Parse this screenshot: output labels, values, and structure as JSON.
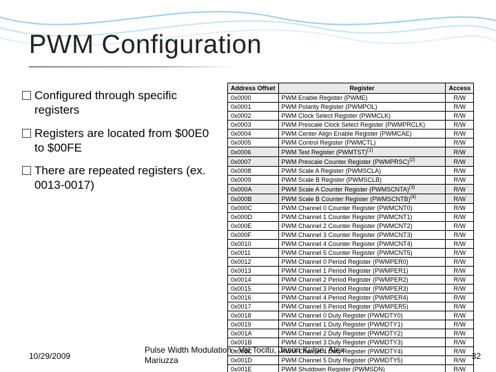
{
  "title": "PWM Configuration",
  "bullets": [
    "Configured through specific registers",
    "Registers are located from $00E0 to $00FE",
    "There are repeated registers (ex. 0013-0017)"
  ],
  "table": {
    "headers": [
      "Address Offset",
      "Register",
      "Access"
    ],
    "rows": [
      {
        "addr": "0x0000",
        "reg": "PWM Enable Register (PWME)",
        "acc": "R/W",
        "shade": false
      },
      {
        "addr": "0x0001",
        "reg": "PWM Polarity Register (PWMPOL)",
        "acc": "R/W",
        "shade": false
      },
      {
        "addr": "0x0002",
        "reg": "PWM Clock Select Register (PWMCLK)",
        "acc": "R/W",
        "shade": false
      },
      {
        "addr": "0x0003",
        "reg": "PWM Prescale Clock Select Register (PWMPRCLK)",
        "acc": "R/W",
        "shade": false
      },
      {
        "addr": "0x0004",
        "reg": "PWM Center Align Enable Register (PWMCAE)",
        "acc": "R/W",
        "shade": false
      },
      {
        "addr": "0x0005",
        "reg": "PWM Control Register (PWMCTL)",
        "acc": "R/W",
        "shade": false
      },
      {
        "addr": "0x0006",
        "reg": "PWM Test Register (PWMTST)",
        "acc": "R/W",
        "shade": true,
        "sup": "(1)"
      },
      {
        "addr": "0x0007",
        "reg": "PWM Prescale Counter Register (PWMPRSC)",
        "acc": "R/W",
        "shade": true,
        "sup": "(2)"
      },
      {
        "addr": "0x0008",
        "reg": "PWM Scale A Register (PWMSCLA)",
        "acc": "R/W",
        "shade": false
      },
      {
        "addr": "0x0009",
        "reg": "PWM Scale B Register (PWMSCLB)",
        "acc": "R/W",
        "shade": false
      },
      {
        "addr": "0x000A",
        "reg": "PWM Scale A Counter Register (PWMSCNTA)",
        "acc": "R/W",
        "shade": true,
        "sup": "(3)"
      },
      {
        "addr": "0x000B",
        "reg": "PWM Scale B Counter Register (PWMSCNTB)",
        "acc": "R/W",
        "shade": true,
        "sup": "(4)"
      },
      {
        "addr": "0x000C",
        "reg": "PWM Channel 0 Counter Register (PWMCNT0)",
        "acc": "R/W",
        "shade": false
      },
      {
        "addr": "0x000D",
        "reg": "PWM Channel 1 Counter Register (PWMCNT1)",
        "acc": "R/W",
        "shade": false
      },
      {
        "addr": "0x000E",
        "reg": "PWM Channel 2 Counter Register (PWMCNT2)",
        "acc": "R/W",
        "shade": false
      },
      {
        "addr": "0x000F",
        "reg": "PWM Channel 3 Counter Register (PWMCNT3)",
        "acc": "R/W",
        "shade": false
      },
      {
        "addr": "0x0010",
        "reg": "PWM Channel 4 Counter Register (PWMCNT4)",
        "acc": "R/W",
        "shade": false
      },
      {
        "addr": "0x0011",
        "reg": "PWM Channel 5 Counter Register (PWMCNT5)",
        "acc": "R/W",
        "shade": false
      },
      {
        "addr": "0x0012",
        "reg": "PWM Channel 0 Period Register (PWMPER0)",
        "acc": "R/W",
        "shade": false
      },
      {
        "addr": "0x0013",
        "reg": "PWM Channel 1 Period Register (PWMPER1)",
        "acc": "R/W",
        "shade": false
      },
      {
        "addr": "0x0014",
        "reg": "PWM Channel 2 Period Register (PWMPER2)",
        "acc": "R/W",
        "shade": false
      },
      {
        "addr": "0x0015",
        "reg": "PWM Channel 3 Period Register (PWMPER3)",
        "acc": "R/W",
        "shade": false
      },
      {
        "addr": "0x0016",
        "reg": "PWM Channel 4 Period Register (PWMPER4)",
        "acc": "R/W",
        "shade": false
      },
      {
        "addr": "0x0017",
        "reg": "PWM Channel 5 Period Register (PWMPER5)",
        "acc": "R/W",
        "shade": false
      },
      {
        "addr": "0x0018",
        "reg": "PWM Channel 0 Duty Register (PWMDTY0)",
        "acc": "R/W",
        "shade": false
      },
      {
        "addr": "0x0019",
        "reg": "PWM Channel 1 Duty Register (PWMDTY1)",
        "acc": "R/W",
        "shade": false
      },
      {
        "addr": "0x001A",
        "reg": "PWM Channel 2 Duty Register (PWMDTY2)",
        "acc": "R/W",
        "shade": false
      },
      {
        "addr": "0x001B",
        "reg": "PWM Channel 3 Duty Register (PWMDTY3)",
        "acc": "R/W",
        "shade": false
      },
      {
        "addr": "0x001C",
        "reg": "PWM Channel 4 Duty Register (PWMDTY4)",
        "acc": "R/W",
        "shade": false
      },
      {
        "addr": "0x001D",
        "reg": "PWM Channel 5 Duty Register (PWMDTY5)",
        "acc": "R/W",
        "shade": false
      },
      {
        "addr": "0x001E",
        "reg": "PWM Shutdown Register (PWMSDN)",
        "acc": "R/W",
        "shade": false
      }
    ]
  },
  "footer": {
    "date": "10/29/2009",
    "authors": "Pulse Width Modulation - Val Tocitu, Jason Kulpe, Alex Mariuzza",
    "page": "32"
  }
}
